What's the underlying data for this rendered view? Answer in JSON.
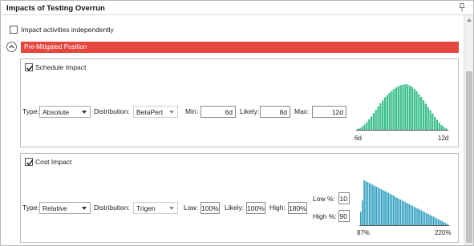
{
  "window": {
    "title": "Impacts of Testing Overrun"
  },
  "impact_independently": {
    "label": "Impact activities independently",
    "checked": false
  },
  "section": {
    "label": "Pre-Mitigated Position",
    "color": "#e5473e"
  },
  "schedule": {
    "title": "Schedule Impact",
    "checked": true,
    "type_label": "Type:",
    "type_value": "Absolute",
    "distribution_label": "Distribution:",
    "distribution_value": "BetaPert",
    "min_label": "Min:",
    "min_value": "6d",
    "likely_label": "Likely:",
    "likely_value": "8d",
    "max_label": "Max:",
    "max_value": "12d",
    "chart": {
      "x_min_label": "6d",
      "x_max_label": "12d",
      "color": "#3dbf8e",
      "bars": [
        2,
        4,
        7,
        11,
        16,
        22,
        28,
        35,
        42,
        49,
        56,
        62,
        68,
        73,
        78,
        82,
        86,
        89,
        92,
        94,
        95,
        96,
        95,
        93,
        90,
        86,
        81,
        75,
        69,
        62,
        55,
        48,
        41,
        34,
        27,
        21,
        15,
        10,
        6,
        3
      ]
    }
  },
  "cost": {
    "title": "Cost Impact",
    "checked": true,
    "type_label": "Type:",
    "type_value": "Relative",
    "distribution_label": "Distribution:",
    "distribution_value": "Trigen",
    "low_label": "Low:",
    "low_value": "100%",
    "likely_label": "Likely:",
    "likely_value": "100%",
    "high_label": "High:",
    "high_value": "180%",
    "low_pct_label": "Low %:",
    "low_pct_value": "10",
    "high_pct_label": "High %:",
    "high_pct_value": "90",
    "chart": {
      "x_min_label": "87%",
      "x_max_label": "220%",
      "color": "#2f9fc0",
      "bars": [
        30,
        55,
        100,
        98,
        96,
        94,
        92,
        90,
        88,
        86,
        84,
        82,
        80,
        78,
        76,
        74,
        72,
        70,
        68,
        66,
        63,
        61,
        59,
        57,
        55,
        53,
        51,
        49,
        47,
        45,
        43,
        41,
        39,
        37,
        35,
        33,
        31,
        29,
        27,
        25,
        23,
        21,
        19,
        17,
        15,
        13,
        11,
        9,
        7,
        5,
        3
      ]
    }
  }
}
